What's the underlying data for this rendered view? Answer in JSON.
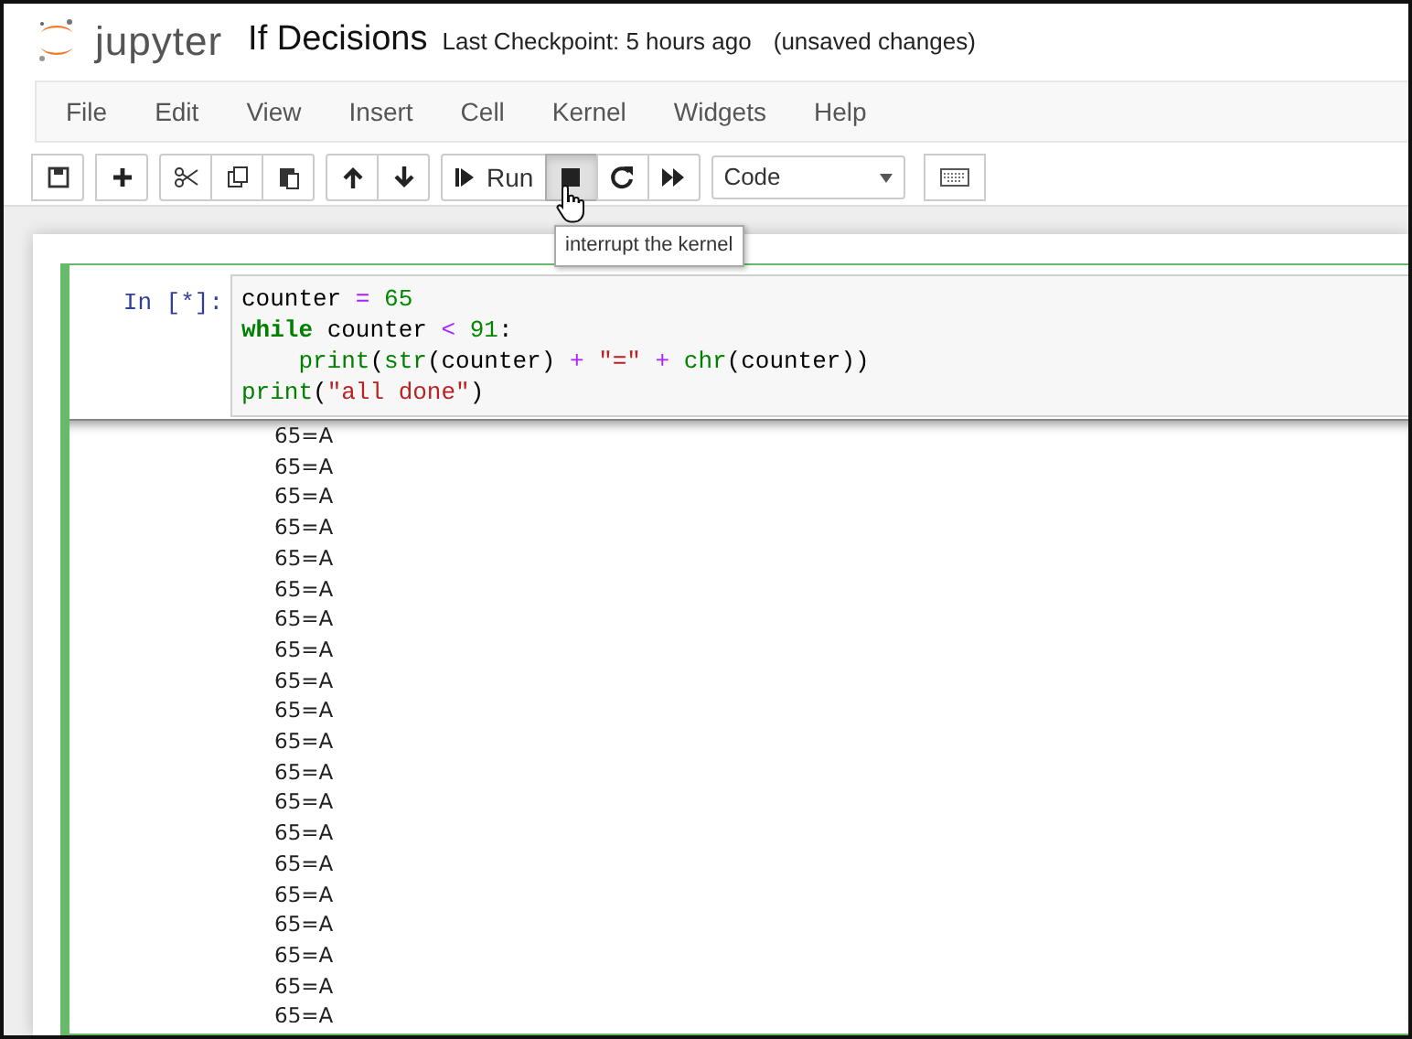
{
  "header": {
    "logo_text": "jupyter",
    "notebook_title": "If Decisions",
    "checkpoint": "Last Checkpoint: 5 hours ago",
    "status": "(unsaved changes)"
  },
  "menu": [
    "File",
    "Edit",
    "View",
    "Insert",
    "Cell",
    "Kernel",
    "Widgets",
    "Help"
  ],
  "toolbar": [
    {
      "buttons": [
        {
          "pressed": false
        }
      ]
    },
    {
      "buttons": [
        {
          "pressed": false
        }
      ]
    },
    {
      "buttons": [
        {
          "pressed": false
        },
        {
          "pressed": false
        },
        {
          "pressed": false
        }
      ]
    },
    {
      "buttons": [
        {
          "pressed": false
        },
        {
          "pressed": false
        }
      ]
    },
    {
      "buttons": [
        {
          "pressed": false,
          "label": "Run"
        },
        {
          "pressed": true
        },
        {
          "pressed": false
        },
        {
          "pressed": false
        }
      ]
    }
  ],
  "cell_type_select": {
    "value": "Code"
  },
  "tooltip": "interrupt the kernel",
  "cell": {
    "prompt": "In [*]:",
    "selected": true,
    "code_lines": [
      [
        {
          "kind": "plain",
          "text": "counter "
        },
        {
          "kind": "op",
          "text": "= "
        },
        {
          "kind": "number",
          "text": "65"
        }
      ],
      [
        {
          "kind": "keyword",
          "text": "while"
        },
        {
          "kind": "plain",
          "text": " counter "
        },
        {
          "kind": "op",
          "text": "< "
        },
        {
          "kind": "number",
          "text": "91"
        },
        {
          "kind": "plain",
          "text": ":"
        }
      ],
      [
        {
          "kind": "builtin",
          "text": "    print"
        },
        {
          "kind": "plain",
          "text": "("
        },
        {
          "kind": "builtin",
          "text": "str"
        },
        {
          "kind": "plain",
          "text": "(counter) "
        },
        {
          "kind": "op",
          "text": "+ "
        },
        {
          "kind": "string",
          "text": "\"=\" "
        },
        {
          "kind": "op",
          "text": "+ "
        },
        {
          "kind": "builtin",
          "text": "chr"
        },
        {
          "kind": "plain",
          "text": "(counter))"
        }
      ],
      [
        {
          "kind": "builtin",
          "text": "print"
        },
        {
          "kind": "plain",
          "text": "("
        },
        {
          "kind": "string",
          "text": "\"all done\""
        },
        {
          "kind": "plain",
          "text": ")"
        }
      ]
    ],
    "output_lines": [
      "65=A",
      "65=A",
      "65=A",
      "65=A",
      "65=A",
      "65=A",
      "65=A",
      "65=A",
      "65=A",
      "65=A",
      "65=A",
      "65=A",
      "65=A",
      "65=A",
      "65=A",
      "65=A",
      "65=A",
      "65=A",
      "65=A",
      "65=A"
    ]
  }
}
